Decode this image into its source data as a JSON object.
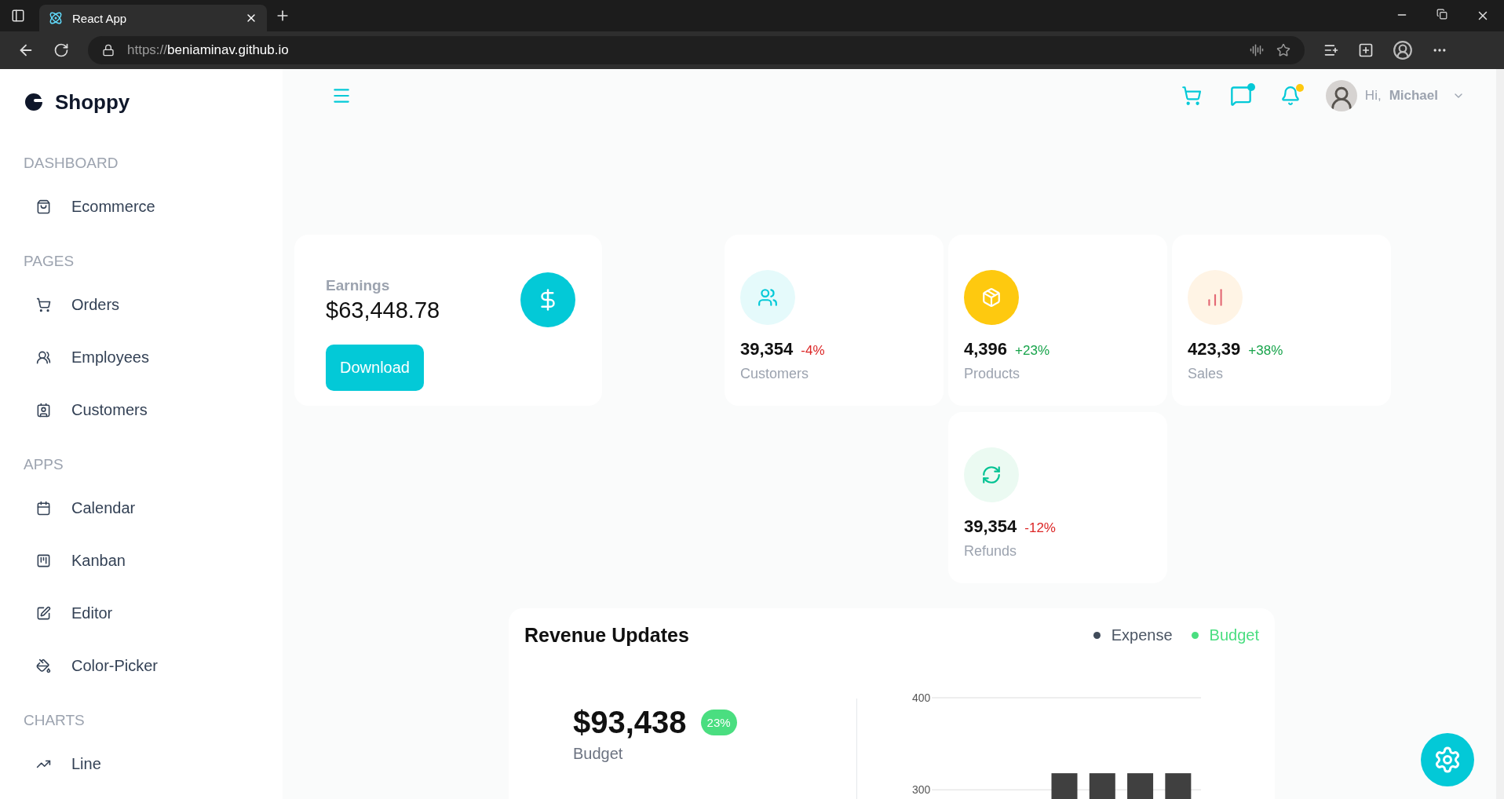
{
  "browser": {
    "tabs": [
      {
        "title": "React App",
        "selected": true
      }
    ],
    "url": {
      "scheme": "https://",
      "host": "beniaminav.github.io"
    }
  },
  "sidebar": {
    "brand": "Shoppy",
    "sections": [
      {
        "title": "DASHBOARD",
        "items": [
          {
            "label": "Ecommerce",
            "selected": false
          }
        ]
      },
      {
        "title": "PAGES",
        "items": [
          {
            "label": "Orders",
            "selected": false
          },
          {
            "label": "Employees",
            "selected": false
          },
          {
            "label": "Customers",
            "selected": false
          }
        ]
      },
      {
        "title": "APPS",
        "items": [
          {
            "label": "Calendar",
            "selected": false
          },
          {
            "label": "Kanban",
            "selected": false
          },
          {
            "label": "Editor",
            "selected": false
          },
          {
            "label": "Color-Picker",
            "selected": false
          }
        ]
      },
      {
        "title": "CHARTS",
        "items": [
          {
            "label": "Line",
            "selected": false
          }
        ]
      }
    ]
  },
  "navbar": {
    "greeting": "Hi,",
    "user": "Michael"
  },
  "earnings": {
    "label": "Earnings",
    "amount": "$63,448.78",
    "button": "Download"
  },
  "stats": [
    {
      "amount": "39,354",
      "change": "-4%",
      "kind": "loss",
      "title": "Customers",
      "color": "#03c9d7"
    },
    {
      "amount": "4,396",
      "change": "+23%",
      "kind": "gain",
      "title": "Products",
      "color": "#ffffff"
    },
    {
      "amount": "423,39",
      "change": "+38%",
      "kind": "gain",
      "title": "Sales",
      "color": "#e46a76"
    },
    {
      "amount": "39,354",
      "change": "-12%",
      "kind": "loss",
      "title": "Refunds",
      "color": "#00c292"
    }
  ],
  "revenue": {
    "title": "Revenue Updates",
    "legend": [
      {
        "label": "Expense",
        "color": "#404b5a"
      },
      {
        "label": "Budget",
        "color": "#4ade80"
      }
    ],
    "budget": {
      "amount": "$93,438",
      "badge": "23%",
      "label": "Budget"
    },
    "chart_data": {
      "type": "bar",
      "ylim": [
        290,
        400
      ],
      "yticks": [
        300,
        400
      ],
      "series": [
        {
          "color": "#404040",
          "values": [
            null,
            null,
            null,
            318,
            318,
            318,
            318
          ]
        }
      ]
    }
  }
}
